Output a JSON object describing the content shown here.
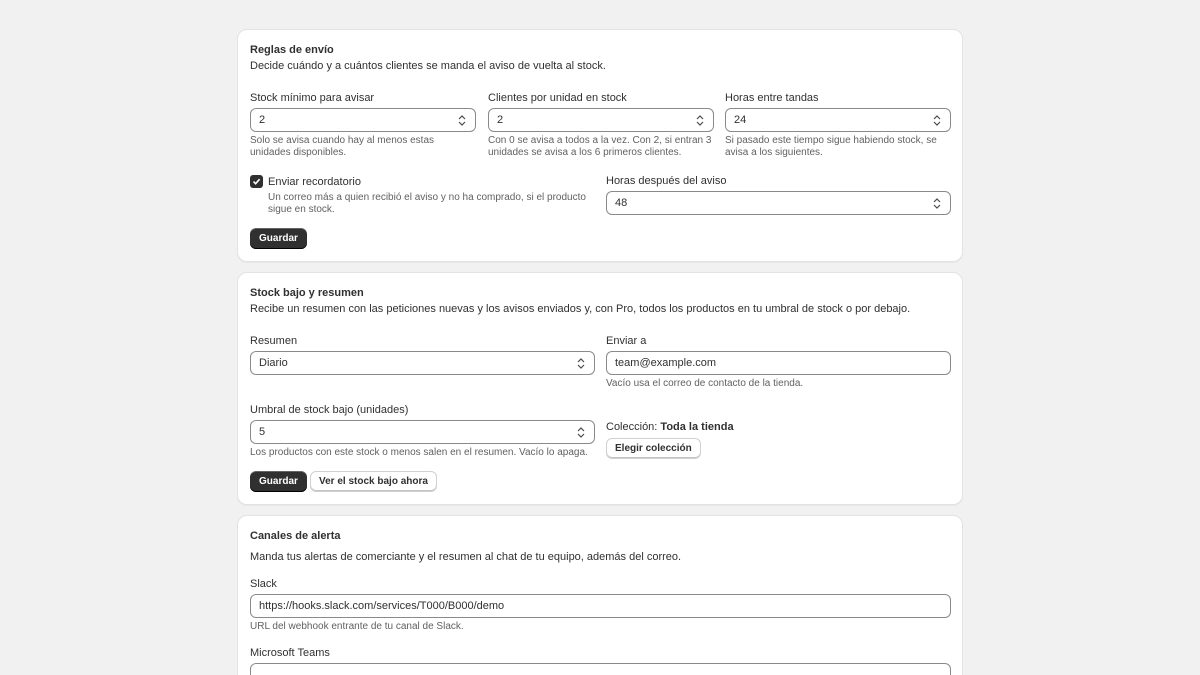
{
  "shipping_rules": {
    "title": "Reglas de envío",
    "description": "Decide cuándo y a cuántos clientes se manda el aviso de vuelta al stock.",
    "min_stock": {
      "label": "Stock mínimo para avisar",
      "value": "2",
      "help": "Solo se avisa cuando hay al menos estas unidades disponibles."
    },
    "clients_per_unit": {
      "label": "Clientes por unidad en stock",
      "value": "2",
      "help": "Con 0 se avisa a todos a la vez. Con 2, si entran 3 unidades se avisa a los 6 primeros clientes."
    },
    "hours_between": {
      "label": "Horas entre tandas",
      "value": "24",
      "help": "Si pasado este tiempo sigue habiendo stock, se avisa a los siguientes."
    },
    "reminder": {
      "label": "Enviar recordatorio",
      "checked": true,
      "help": "Un correo más a quien recibió el aviso y no ha comprado, si el producto sigue en stock."
    },
    "hours_after": {
      "label": "Horas después del aviso",
      "value": "48"
    },
    "save_label": "Guardar"
  },
  "low_stock": {
    "title": "Stock bajo y resumen",
    "description": "Recibe un resumen con las peticiones nuevas y los avisos enviados y, con Pro, todos los productos en tu umbral de stock o por debajo.",
    "summary": {
      "label": "Resumen",
      "value": "Diario"
    },
    "send_to": {
      "label": "Enviar a",
      "value": "team@example.com",
      "help": "Vacío usa el correo de contacto de la tienda."
    },
    "threshold": {
      "label": "Umbral de stock bajo (unidades)",
      "value": "5",
      "help": "Los productos con este stock o menos salen en el resumen. Vacío lo apaga."
    },
    "collection": {
      "label": "Colección:",
      "value": "Toda la tienda",
      "button_label": "Elegir colección"
    },
    "save_label": "Guardar",
    "view_label": "Ver el stock bajo ahora"
  },
  "alert_channels": {
    "title": "Canales de alerta",
    "description": "Manda tus alertas de comerciante y el resumen al chat de tu equipo, además del correo.",
    "slack": {
      "label": "Slack",
      "value": "https://hooks.slack.com/services/T000/B000/demo",
      "help": "URL del webhook entrante de tu canal de Slack."
    },
    "teams": {
      "label": "Microsoft Teams",
      "value": ""
    }
  },
  "icons": {
    "spinner": "up-down-arrows-icon",
    "select": "chevron-up-down-icon",
    "check": "checkmark-icon"
  }
}
